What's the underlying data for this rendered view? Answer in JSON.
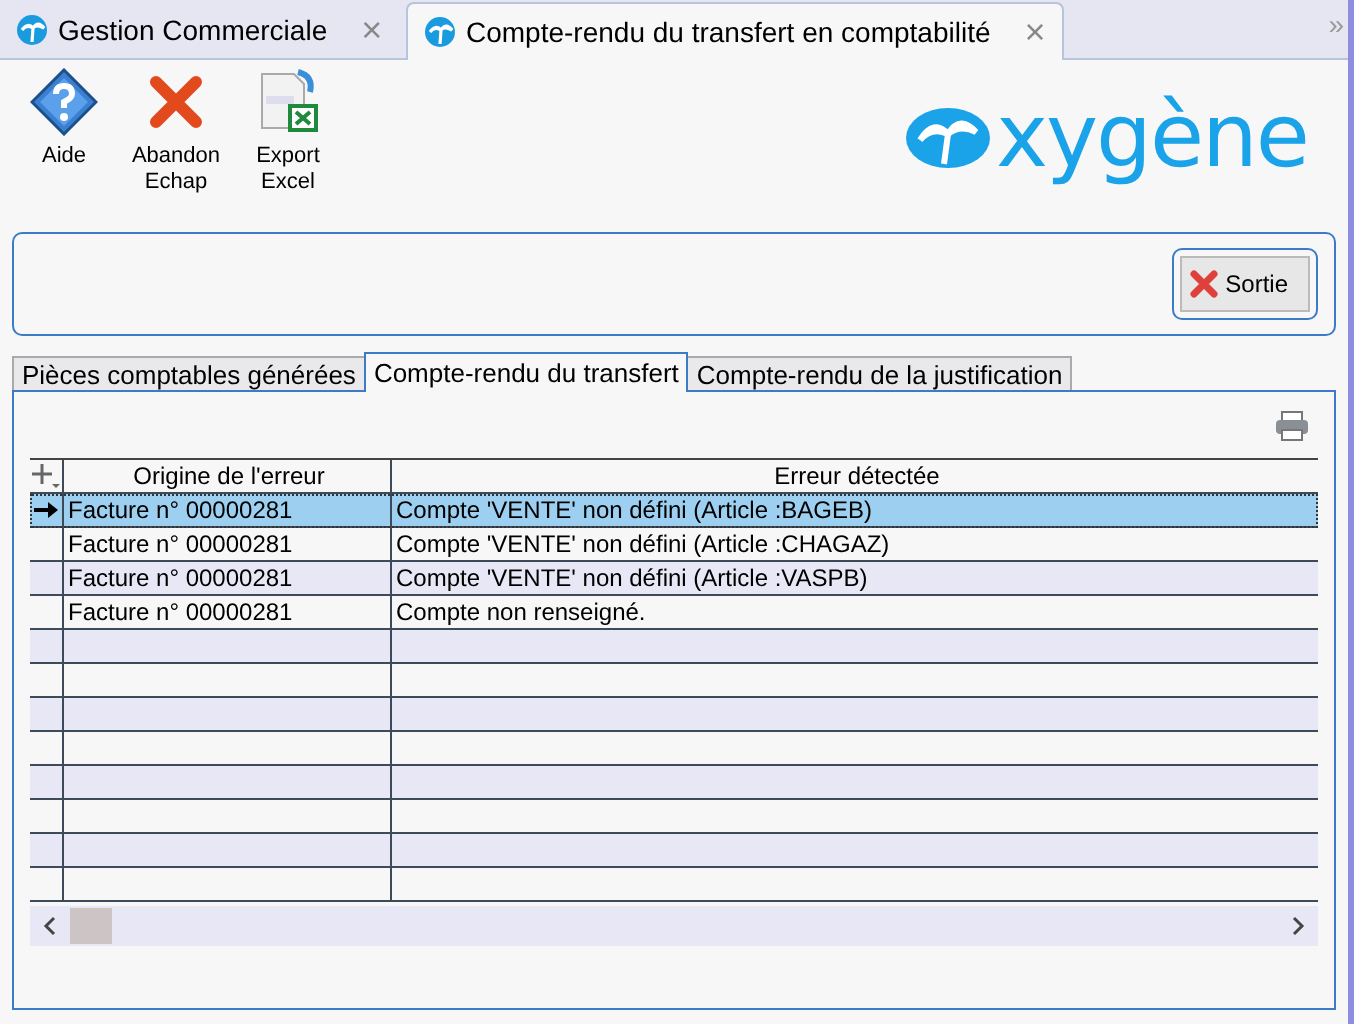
{
  "window_tabs": [
    {
      "label": "Gestion Commerciale",
      "selected": false,
      "close": "×"
    },
    {
      "label": "Compte-rendu du transfert en comptabilité",
      "selected": true,
      "close": "×"
    }
  ],
  "tab_overflow": "»",
  "toolbar": [
    {
      "kind": "help",
      "label": "Aide"
    },
    {
      "kind": "cancel",
      "label": "Abandon\nEchap"
    },
    {
      "kind": "excel",
      "label": "Export\nExcel"
    }
  ],
  "logo": {
    "text": "xygène"
  },
  "exit_button": {
    "label": "Sortie"
  },
  "tabs": [
    {
      "label": "Pièces comptables générées",
      "selected": false
    },
    {
      "label": "Compte-rendu du transfert",
      "selected": true
    },
    {
      "label": "Compte-rendu de la justification",
      "selected": false
    }
  ],
  "table": {
    "columns": [
      "Origine de l'erreur",
      "Erreur détectée"
    ],
    "rows": [
      {
        "origin": "Facture n° 00000281",
        "error": "Compte 'VENTE' non défini (Article :BAGEB)",
        "selected": true
      },
      {
        "origin": "Facture n° 00000281",
        "error": "Compte 'VENTE' non défini (Article :CHAGAZ)",
        "selected": false
      },
      {
        "origin": "Facture n° 00000281",
        "error": "Compte 'VENTE' non défini (Article :VASPB)",
        "selected": false
      },
      {
        "origin": "Facture n° 00000281",
        "error": "Compte non renseigné.",
        "selected": false
      }
    ]
  }
}
